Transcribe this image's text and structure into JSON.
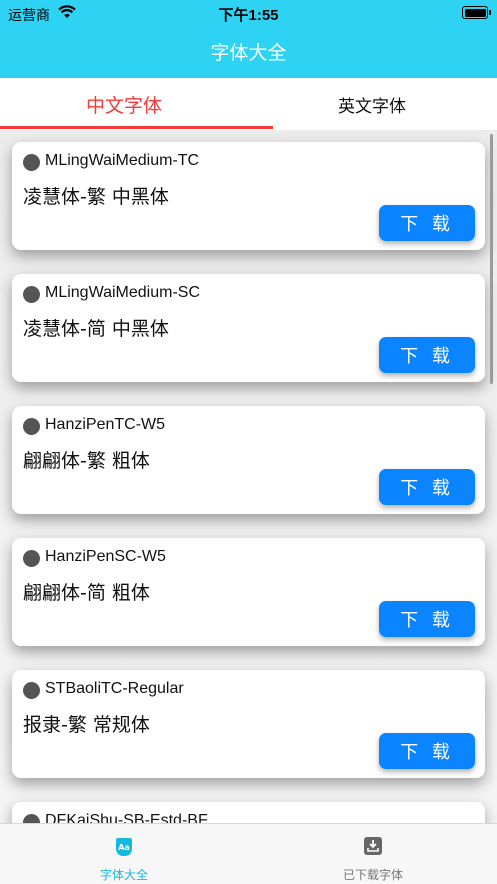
{
  "status_bar": {
    "carrier": "运营商",
    "time": "下午1:55"
  },
  "nav": {
    "title": "字体大全"
  },
  "tabs": {
    "chinese": "中文字体",
    "english": "英文字体"
  },
  "download_label": "下 载",
  "fonts": [
    {
      "name": "MLingWaiMedium-TC",
      "desc": "凌慧体-繁 中黑体"
    },
    {
      "name": "MLingWaiMedium-SC",
      "desc": "凌慧体-简 中黑体"
    },
    {
      "name": "HanziPenTC-W5",
      "desc": "翩翩体-繁 粗体"
    },
    {
      "name": "HanziPenSC-W5",
      "desc": "翩翩体-简 粗体"
    },
    {
      "name": "STBaoliTC-Regular",
      "desc": "报隶-繁 常规体"
    },
    {
      "name": "DFKaiShu-SB-Estd-BF",
      "desc": ""
    }
  ],
  "tab_bar": {
    "fonts_label": "字体大全",
    "downloaded_label": "已下载字体",
    "fonts_icon": "font-aa-icon",
    "downloaded_icon": "download-tray-icon"
  },
  "colors": {
    "accent": "#2ed3f3",
    "active_tab": "#f23a3a",
    "button": "#0a84ff"
  }
}
